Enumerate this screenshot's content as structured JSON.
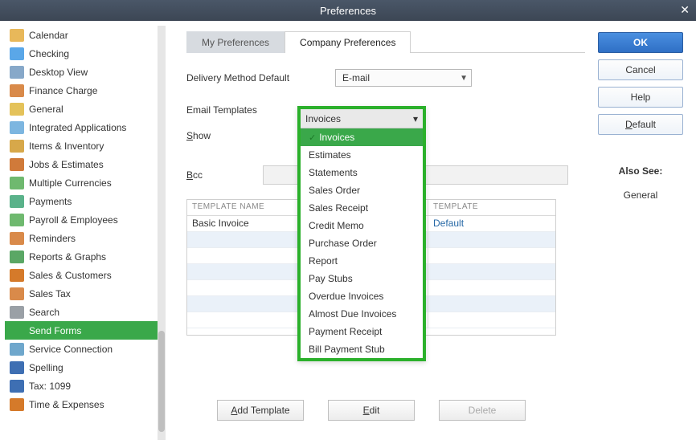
{
  "window": {
    "title": "Preferences"
  },
  "sidebar": {
    "items": [
      {
        "label": "Calendar",
        "color": "#e8b85a"
      },
      {
        "label": "Checking",
        "color": "#5aa7e8"
      },
      {
        "label": "Desktop View",
        "color": "#87a8c9"
      },
      {
        "label": "Finance Charge",
        "color": "#d98a4a"
      },
      {
        "label": "General",
        "color": "#e4c25a"
      },
      {
        "label": "Integrated Applications",
        "color": "#7db6e0"
      },
      {
        "label": "Items & Inventory",
        "color": "#d7a84a"
      },
      {
        "label": "Jobs & Estimates",
        "color": "#d07a3a"
      },
      {
        "label": "Multiple Currencies",
        "color": "#6fb96f"
      },
      {
        "label": "Payments",
        "color": "#5ab28a"
      },
      {
        "label": "Payroll & Employees",
        "color": "#6fb96f"
      },
      {
        "label": "Reminders",
        "color": "#d98a4a"
      },
      {
        "label": "Reports & Graphs",
        "color": "#5aa765"
      },
      {
        "label": "Sales & Customers",
        "color": "#d57a2a"
      },
      {
        "label": "Sales Tax",
        "color": "#d98a4a"
      },
      {
        "label": "Search",
        "color": "#9aa0a6"
      },
      {
        "label": "Send Forms",
        "color": "#3aa84a",
        "selected": true
      },
      {
        "label": "Service Connection",
        "color": "#6fa7cc"
      },
      {
        "label": "Spelling",
        "color": "#3e6fb3"
      },
      {
        "label": "Tax: 1099",
        "color": "#3e6fb3"
      },
      {
        "label": "Time & Expenses",
        "color": "#d57a2a"
      }
    ]
  },
  "tabs": {
    "my": "My Preferences",
    "company": "Company Preferences"
  },
  "form": {
    "delivery_label": "Delivery Method Default",
    "delivery_value": "E-mail",
    "email_templates_label": "Email Templates",
    "show_label": "Show",
    "bcc_label": "Bcc"
  },
  "dropdown": {
    "selected": "Invoices",
    "items": [
      "Invoices",
      "Estimates",
      "Statements",
      "Sales Order",
      "Sales Receipt",
      "Credit Memo",
      "Purchase Order",
      "Report",
      "Pay Stubs",
      "Overdue Invoices",
      "Almost Due Invoices",
      "Payment Receipt",
      "Bill Payment Stub"
    ]
  },
  "table": {
    "col1": "TEMPLATE NAME",
    "col2": "TEMPLATE",
    "rows": [
      {
        "name": "Basic Invoice",
        "template": "Default"
      }
    ]
  },
  "buttons": {
    "add": "Add Template",
    "edit": "Edit",
    "delete": "Delete"
  },
  "right": {
    "ok": "OK",
    "cancel": "Cancel",
    "help": "Help",
    "default": "Default",
    "also_see_h": "Also See:",
    "also_see_link": "General"
  }
}
